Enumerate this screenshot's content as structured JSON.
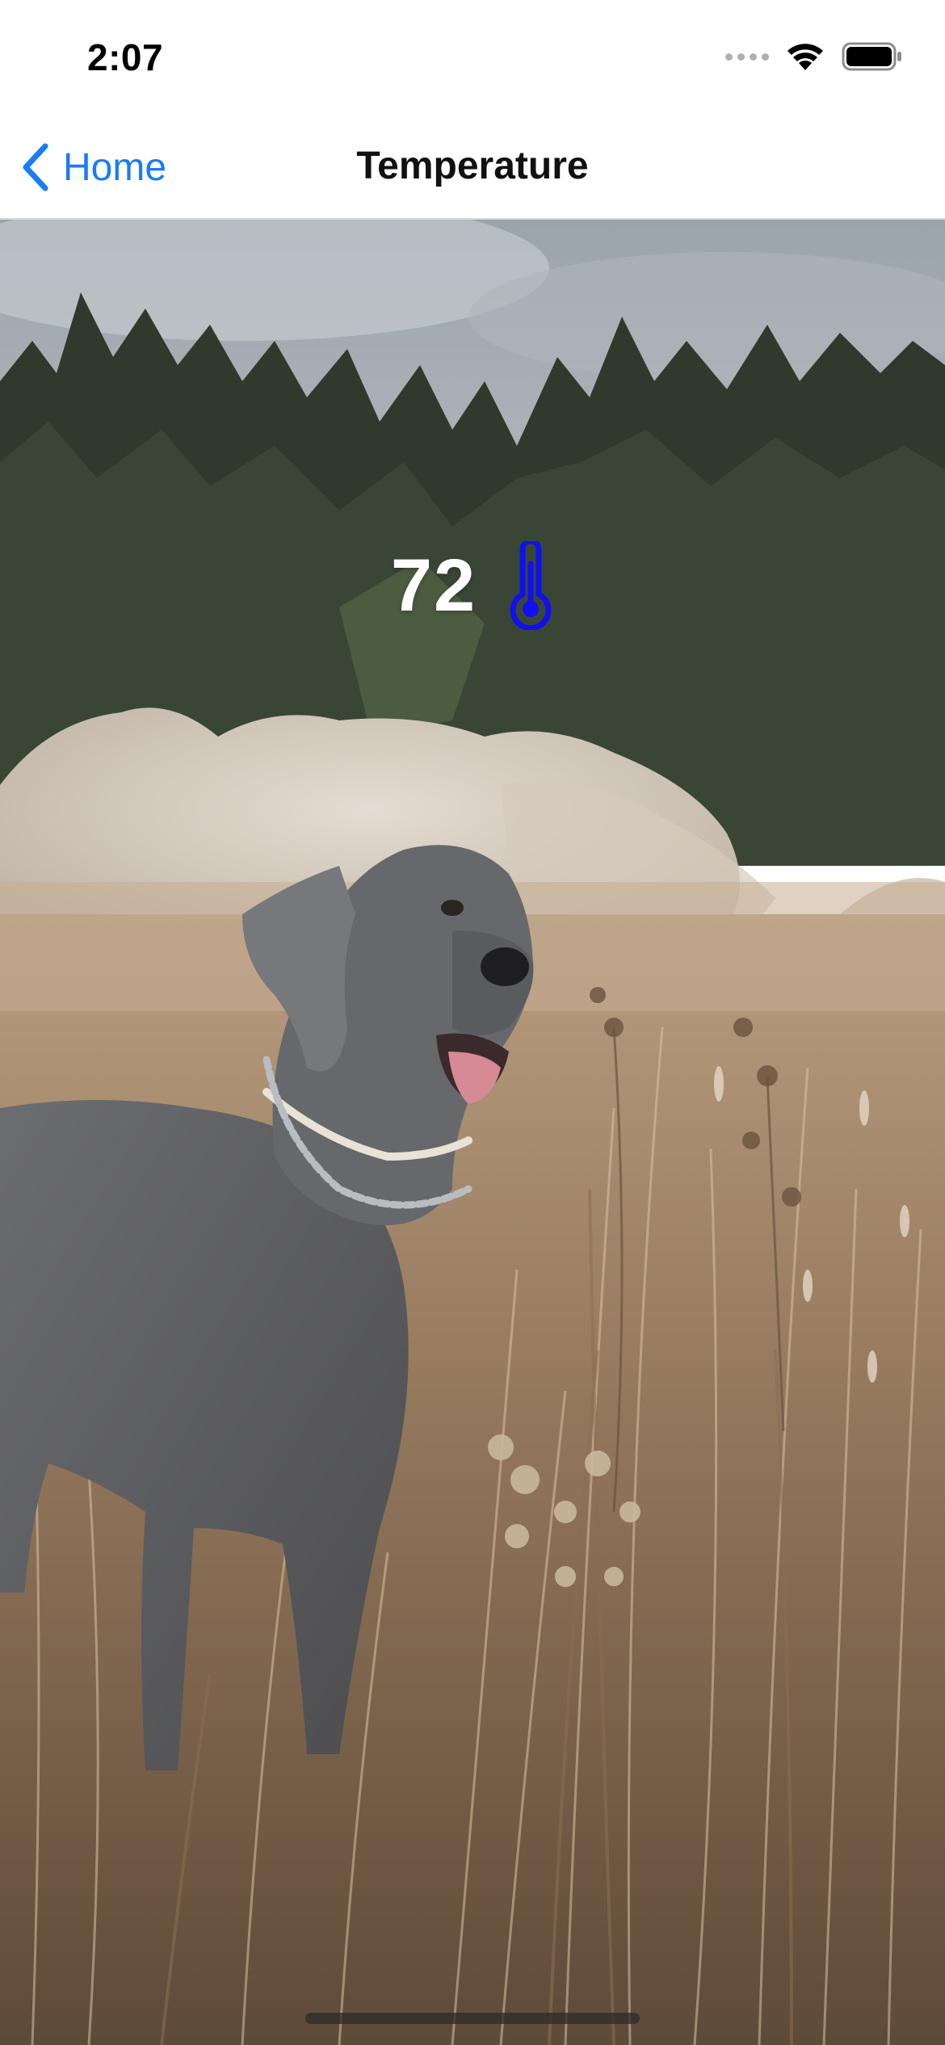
{
  "status_bar": {
    "time": "2:07",
    "signal_icon": "cellular-signal-dots-icon",
    "wifi_icon": "wifi-icon",
    "battery_icon": "battery-full-icon"
  },
  "nav_bar": {
    "back_label": "Home",
    "back_icon": "chevron-left-icon",
    "title": "Temperature",
    "accent_color": "#1a7cf5"
  },
  "content": {
    "temperature_value": "72",
    "thermometer_icon": "thermometer-icon",
    "thermometer_color": "#1010ee",
    "background_photo": "dog-in-tall-grass-photo"
  }
}
